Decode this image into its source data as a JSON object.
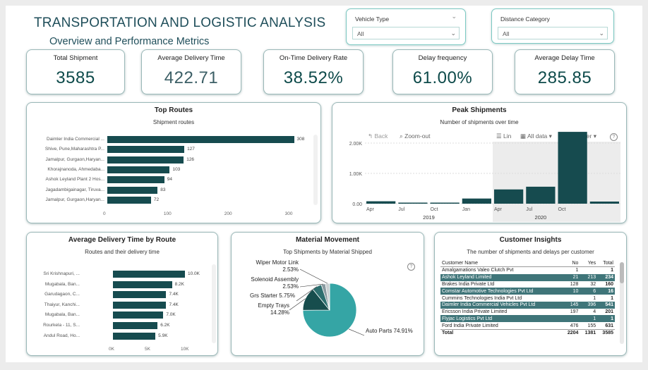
{
  "header": {
    "title": "TRANSPORTATION AND LOGISTIC ANALYSIS",
    "subtitle": "Overview and Performance Metrics"
  },
  "slicers": {
    "vehicle_type": {
      "label": "Vehicle Type",
      "value": "All"
    },
    "distance_category": {
      "label": "Distance Category",
      "value": "All"
    }
  },
  "kpis": [
    {
      "label": "Total Shipment",
      "value": "3585"
    },
    {
      "label": "Average Delivery Time",
      "value": "422.71"
    },
    {
      "label": "On-Time Delivery Rate",
      "value": "38.52%"
    },
    {
      "label": "Delay frequency",
      "value": "61.00%"
    },
    {
      "label": "Average Delay Time",
      "value": "285.85"
    }
  ],
  "top_routes": {
    "title": "Top Routes",
    "subtitle": "Shipment routes"
  },
  "peak_shipments": {
    "title": "Peak Shipments",
    "subtitle": "Number of shipments over time",
    "toolbar": {
      "back": "Back",
      "zoom_out": "Zoom-out",
      "lin": "Lin",
      "all_data": "All data",
      "quarter": "quarter"
    },
    "year_labels": [
      "2019",
      "2020"
    ]
  },
  "avg_delivery": {
    "title": "Average Delivery Time by Route",
    "subtitle": "Routes and their delivery time"
  },
  "material": {
    "title": "Material Movement",
    "subtitle": "Top Shipments by Material Shipped",
    "labels": {
      "wiper": [
        "Wiper Motor Link",
        "2.53%"
      ],
      "solenoid": [
        "Solenoid Assembly",
        "2.53%"
      ],
      "grs": [
        "Grs Starter 5.75%"
      ],
      "empty": [
        "Empty Trays",
        "14.28%"
      ],
      "auto": [
        "Auto Parts 74.91%"
      ]
    }
  },
  "customer": {
    "title": "Customer Insights",
    "subtitle": "The number of shipments and delays per customer",
    "columns": [
      "Customer Name",
      "No",
      "Yes",
      "Total"
    ],
    "rows": [
      {
        "name": "Amalgamations Valeo Clutch Pvt",
        "no": "1",
        "yes": "",
        "total": "1",
        "hl": false
      },
      {
        "name": "Ashok Leyland Limited",
        "no": "21",
        "yes": "213",
        "total": "234",
        "hl": true
      },
      {
        "name": "Brakes India Private Ltd",
        "no": "128",
        "yes": "32",
        "total": "160",
        "hl": false
      },
      {
        "name": "Comstar Automotive Technologies Pvt Ltd",
        "no": "10",
        "yes": "6",
        "total": "16",
        "hl": true
      },
      {
        "name": "Cummins Technologies India Pvt Ltd",
        "no": "",
        "yes": "1",
        "total": "1",
        "hl": false
      },
      {
        "name": "Daimler India Commercial Vehicles Pvt Ltd",
        "no": "145",
        "yes": "396",
        "total": "541",
        "hl": true
      },
      {
        "name": "Ericsson India Private Limited",
        "no": "197",
        "yes": "4",
        "total": "201",
        "hl": false
      },
      {
        "name": "Flyjac Logistics Pvt Ltd",
        "no": "",
        "yes": "1",
        "total": "1",
        "hl": true
      },
      {
        "name": "Ford India Private Limited",
        "no": "476",
        "yes": "155",
        "total": "631",
        "hl": false
      }
    ],
    "total": {
      "name": "Total",
      "no": "2204",
      "yes": "1381",
      "total": "3585"
    }
  },
  "chart_data": [
    {
      "type": "bar",
      "orientation": "horizontal",
      "title": "Top Routes",
      "subtitle": "Shipment routes",
      "categories": [
        "Daimler India Commercial ...",
        "Shive, Pune,Maharashtra P...",
        "Jamalpur, Gurgaon,Haryan...",
        "Khorajnanoda, Ahmedaba...",
        "Ashok Leyland Plant 2 Hos...",
        "Jagadambigainagar, Tiruva...",
        "Jamalpur, Gurgaon,Haryan..."
      ],
      "values": [
        308,
        127,
        126,
        103,
        94,
        83,
        72
      ],
      "xticks": [
        "0",
        "100",
        "200",
        "300"
      ],
      "xlim": [
        0,
        340
      ]
    },
    {
      "type": "bar",
      "title": "Peak Shipments",
      "subtitle": "Number of shipments over time",
      "categories": [
        "2019 Q1",
        "2019 Q2",
        "2019 Q3",
        "2019 Q4",
        "2020 Q1",
        "2020 Q2",
        "2020 Q3",
        "2020 Q4"
      ],
      "xticks": [
        "Apr",
        "Jul",
        "Oct",
        "Jan",
        "Apr",
        "Jul",
        "Oct"
      ],
      "values": [
        80,
        10,
        20,
        170,
        470,
        560,
        2370,
        70
      ],
      "yticks": [
        "0.00",
        "1.00K",
        "2.00K"
      ],
      "ylim": [
        0,
        2500
      ],
      "highlighted_categories": [
        "2020 Q1",
        "2020 Q2",
        "2020 Q3",
        "2020 Q4"
      ]
    },
    {
      "type": "bar",
      "orientation": "horizontal",
      "title": "Average Delivery Time by Route",
      "subtitle": "Routes and their delivery time",
      "categories": [
        "Sri Krishnapuri, ...",
        "Mugabala, Ban...",
        "Garudagaon, C...",
        "Thaiyur, Kanchi...",
        "Mugabala, Ban...",
        "Rourkela - 11, S...",
        "Andul Road, Ho..."
      ],
      "values": [
        10000,
        8200,
        7400,
        7400,
        7000,
        6200,
        5900
      ],
      "value_labels": [
        "10.0K",
        "8.2K",
        "7.4K",
        "7.4K",
        "7.0K",
        "6.2K",
        "5.9K"
      ],
      "xticks": [
        "0K",
        "5K",
        "10K"
      ],
      "xlim": [
        0,
        10000
      ]
    },
    {
      "type": "pie",
      "title": "Material Movement",
      "subtitle": "Top Shipments by Material Shipped",
      "labels": [
        "Auto Parts",
        "Empty Trays",
        "Grs Starter",
        "Solenoid Assembly",
        "Wiper Motor Link"
      ],
      "values": [
        74.91,
        14.28,
        5.75,
        2.53,
        2.53
      ],
      "colors": [
        "#35a5a5",
        "#174d4d",
        "#2d6f6f",
        "#8a9aa0",
        "#c9d0d2"
      ]
    }
  ]
}
